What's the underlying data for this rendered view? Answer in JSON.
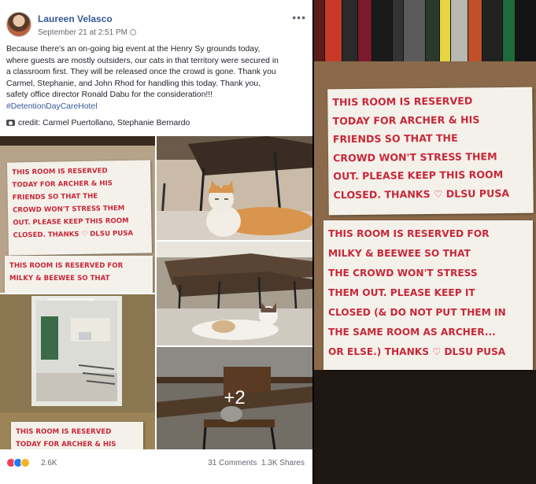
{
  "post": {
    "author": "Laureen Velasco",
    "timestamp": "September 21 at 2:51 PM",
    "more_label": "•••",
    "text_lines": [
      "Because there's an on-going big event at the Henry Sy grounds today,",
      "where guests are mostly outsiders, our cats in that territory were secured in",
      "a classroom first. They will be released once the crowd is gone. Thank you",
      "Carmel, Stephanie, and John Rhod for handling this today. Thank you,",
      "safety office director Ronald Dabu for the consideration!!!"
    ],
    "hashtag": "#DetentionDayCareHotel",
    "credit": "credit: Carmel Puertollano, Stephanie Bernardo",
    "more_photos": "+2",
    "reaction_count": "2.6K",
    "comments": "31 Comments",
    "shares": "1.3K Shares"
  },
  "signs": {
    "archer": [
      "This room is reserved",
      "today for Archer & his",
      "friends so that the",
      "crowd won't stress them",
      "out. Please keep this room",
      "closed. Thanks ♡ DLSU PUSA"
    ],
    "milky": [
      "This room is reserved for",
      "Milky & Beewee so that",
      "the crowd won't stress",
      "them out. Please keep it",
      "closed (& do not put them in",
      "the same room as Archer...",
      "or else.) Thanks ♡ DLSU PUSA"
    ],
    "grid_archer": [
      "This room is reserved",
      "today for Archer & his",
      "friends so that the",
      "crowd won't stress them",
      "out. Please keep this room",
      "closed. Thanks ♡ DLSU PUSA"
    ],
    "grid_milky": [
      "This room is reserved for",
      "Milky & Beewee so that"
    ],
    "door": [
      "This room is reserved",
      "today for Archer & his"
    ]
  },
  "colors": {
    "link": "#385898",
    "ink": "#c8283a"
  }
}
